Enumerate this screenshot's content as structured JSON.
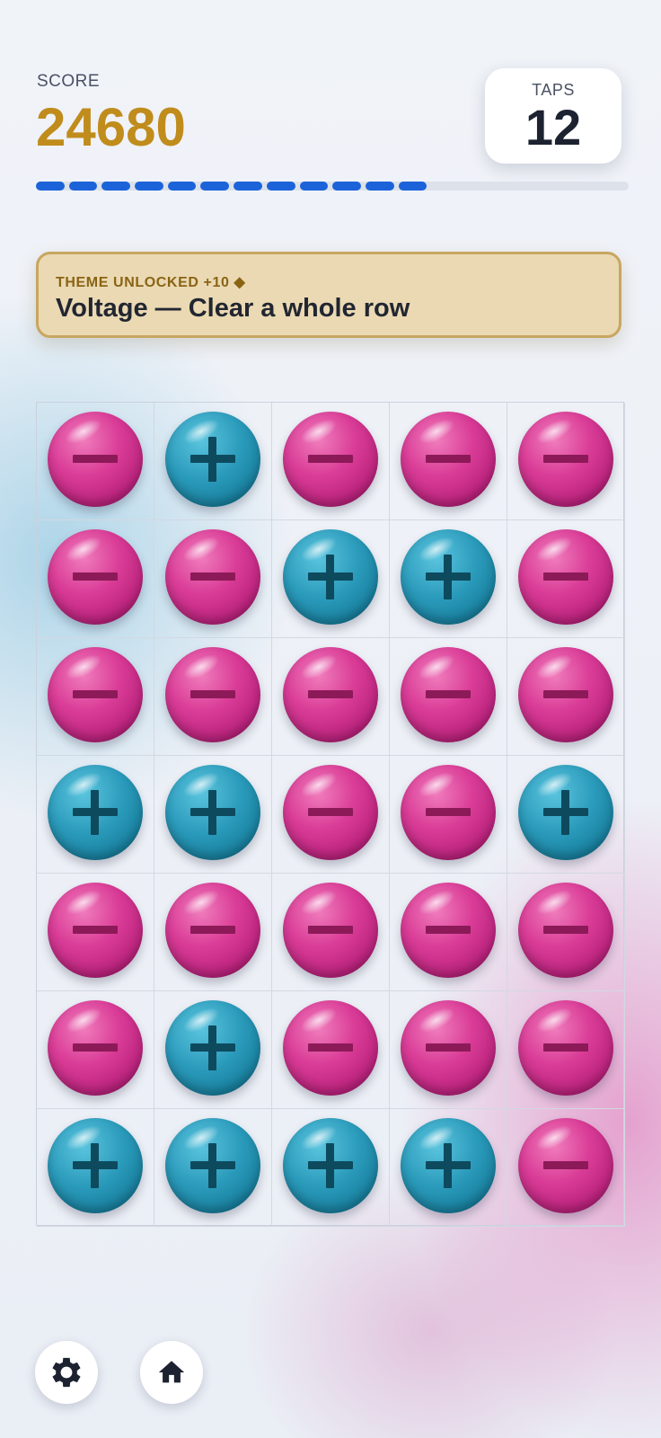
{
  "header": {
    "score_label": "SCORE",
    "score_value": "24680",
    "taps_label": "TAPS",
    "taps_value": "12"
  },
  "progress": {
    "filled_segments": 12,
    "fraction": 0.66
  },
  "banner": {
    "kicker": "THEME UNLOCKED  +10 ◆",
    "title": "Voltage — Clear a whole row"
  },
  "board": {
    "rows": [
      [
        "minus",
        "plus",
        "minus",
        "minus",
        "minus"
      ],
      [
        "minus",
        "minus",
        "plus",
        "plus",
        "minus"
      ],
      [
        "minus",
        "minus",
        "minus",
        "minus",
        "minus"
      ],
      [
        "plus",
        "plus",
        "minus",
        "minus",
        "plus"
      ],
      [
        "minus",
        "minus",
        "minus",
        "minus",
        "minus"
      ],
      [
        "minus",
        "plus",
        "minus",
        "minus",
        "minus"
      ],
      [
        "plus",
        "plus",
        "plus",
        "plus",
        "minus"
      ]
    ]
  },
  "colors": {
    "score": "#c08c1c",
    "progress": "#1c63d9",
    "minus_orb": "#da3d97",
    "plus_orb": "#2b9bbb",
    "banner_bg": "#ead9b3"
  },
  "buttons": {
    "settings_icon": "gear-icon",
    "home_icon": "home-icon"
  }
}
